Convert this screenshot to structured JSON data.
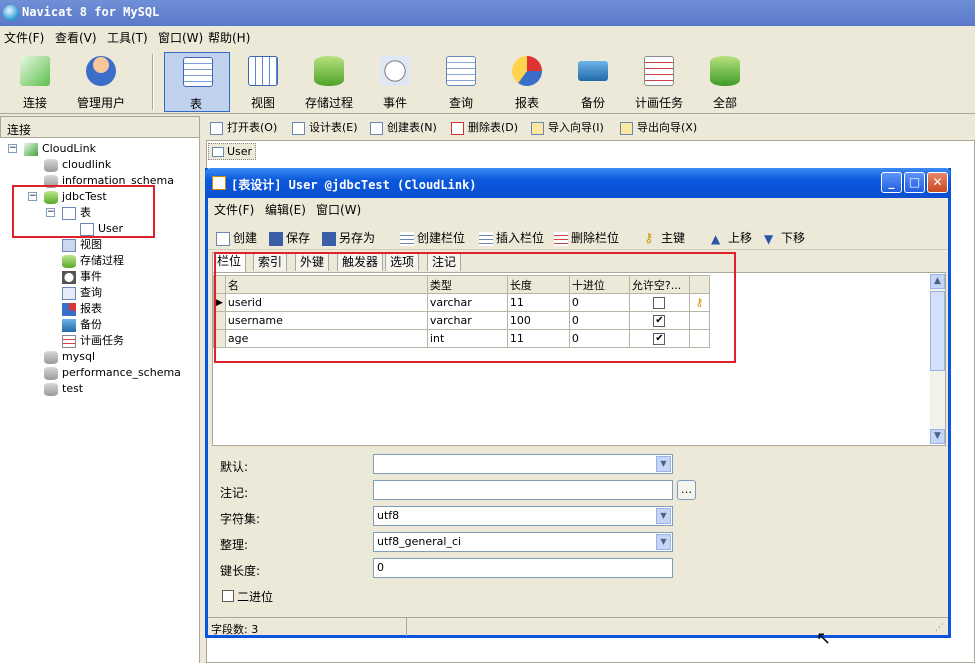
{
  "app": {
    "title": "Navicat 8 for MySQL"
  },
  "menu": [
    "文件(F)",
    "查看(V)",
    "工具(T)",
    "窗口(W)",
    "帮助(H)"
  ],
  "toolbar": {
    "items": [
      {
        "label": "连接",
        "icon": "connect-icon"
      },
      {
        "label": "管理用户",
        "icon": "user-icon"
      },
      {
        "label": "表",
        "icon": "table-icon",
        "selected": true
      },
      {
        "label": "视图",
        "icon": "view-icon"
      },
      {
        "label": "存储过程",
        "icon": "procedure-icon"
      },
      {
        "label": "事件",
        "icon": "event-icon"
      },
      {
        "label": "查询",
        "icon": "query-icon"
      },
      {
        "label": "报表",
        "icon": "report-icon"
      },
      {
        "label": "备份",
        "icon": "backup-icon"
      },
      {
        "label": "计画任务",
        "icon": "schedule-icon"
      },
      {
        "label": "全部",
        "icon": "all-icon"
      }
    ]
  },
  "sidebar": {
    "header": "连接",
    "tree": {
      "root": "CloudLink",
      "dbs": [
        "cloudlink",
        "information_schema",
        "jdbcTest",
        "mysql",
        "performance_schema",
        "test"
      ],
      "jdbc_children": [
        "表",
        "视图",
        "存储过程",
        "事件",
        "查询",
        "报表",
        "备份",
        "计画任务"
      ],
      "table_item": "User"
    }
  },
  "subtoolbar": [
    "打开表(O)",
    "设计表(E)",
    "创建表(N)",
    "删除表(D)",
    "导入向导(I)",
    "导出向导(X)"
  ],
  "objects": [
    "User"
  ],
  "designer": {
    "title": "[表设计] User @jdbcTest (CloudLink)",
    "menu": [
      "文件(F)",
      "编辑(E)",
      "窗口(W)"
    ],
    "toolbar": [
      "创建",
      "保存",
      "另存为",
      "创建栏位",
      "插入栏位",
      "删除栏位",
      "主键",
      "上移",
      "下移"
    ],
    "tabs": [
      "栏位",
      "索引",
      "外键",
      "触发器",
      "选项",
      "注记"
    ],
    "columns": [
      "名",
      "类型",
      "长度",
      "十进位",
      "允许空?..."
    ],
    "rows": [
      {
        "name": "userid",
        "type": "varchar",
        "length": "11",
        "decimal": "0",
        "nullable": false,
        "key": true
      },
      {
        "name": "username",
        "type": "varchar",
        "length": "100",
        "decimal": "0",
        "nullable": true,
        "key": false
      },
      {
        "name": "age",
        "type": "int",
        "length": "11",
        "decimal": "0",
        "nullable": true,
        "key": false
      }
    ],
    "props": {
      "default_label": "默认:",
      "default_value": "",
      "comment_label": "注记:",
      "comment_value": "",
      "charset_label": "字符集:",
      "charset_value": "utf8",
      "collation_label": "整理:",
      "collation_value": "utf8_general_ci",
      "keylen_label": "键长度:",
      "keylen_value": "0",
      "binary_label": "二进位"
    },
    "status": "字段数: 3"
  },
  "colors": {
    "accent": "#316ac5",
    "highlight": "#e0202a"
  }
}
